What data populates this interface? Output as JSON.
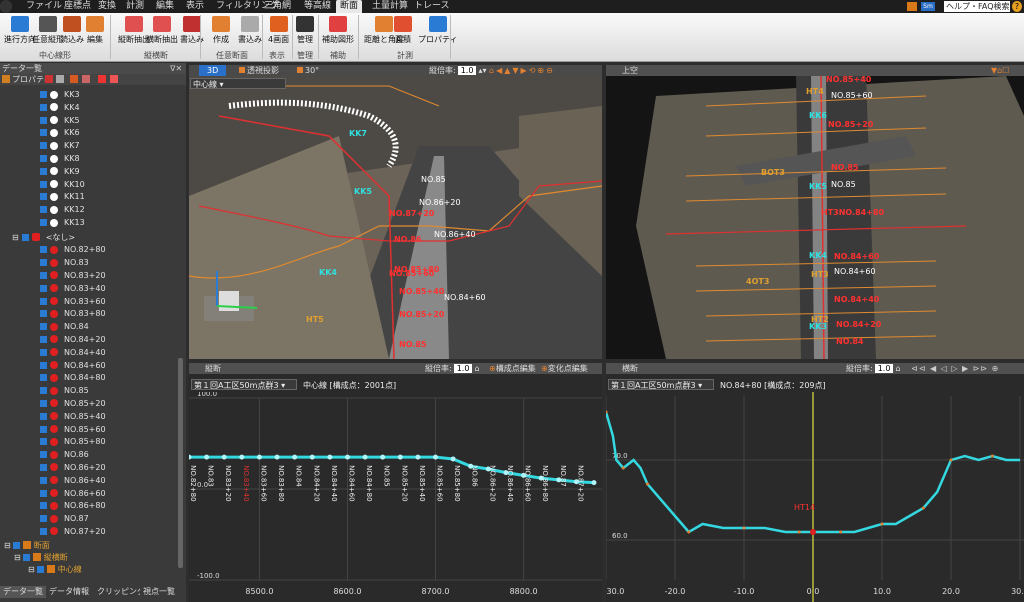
{
  "menu": {
    "tabs": [
      "ファイル",
      "座標点",
      "変換",
      "計測",
      "編集",
      "表示",
      "フィルタリング",
      "三角網",
      "等高線",
      "断面",
      "土量計算",
      "トレース"
    ],
    "active": "断面",
    "help_search": "ヘルプ・FAQ検索",
    "help_btn": "?"
  },
  "ribbon": {
    "buttons": [
      "進行方向",
      "任意縦形",
      "読込み",
      "編集",
      "縦断抽出",
      "横断抽出",
      "書込み",
      "作成",
      "書込み",
      "4画面",
      "管理",
      "補助図形",
      "距離と角度",
      "面積",
      "プロパティ"
    ],
    "groups": [
      "中心線形",
      "縦横断",
      "任意断面",
      "表示",
      "管理",
      "補助",
      "計測"
    ]
  },
  "left_panel": {
    "title": "データ一覧",
    "toolbar_label": "プロパティ",
    "kk_items": [
      "KK3",
      "KK4",
      "KK5",
      "KK6",
      "KK7",
      "KK8",
      "KK9",
      "KK10",
      "KK11",
      "KK12",
      "KK13"
    ],
    "group_label": "<なし>",
    "no_items": [
      "NO.82+80",
      "NO.83",
      "NO.83+20",
      "NO.83+40",
      "NO.83+60",
      "NO.83+80",
      "NO.84",
      "NO.84+20",
      "NO.84+40",
      "NO.84+60",
      "NO.84+80",
      "NO.85",
      "NO.85+20",
      "NO.85+40",
      "NO.85+60",
      "NO.85+80",
      "NO.86",
      "NO.86+20",
      "NO.86+40",
      "NO.86+60",
      "NO.86+80",
      "NO.87",
      "NO.87+20"
    ],
    "section_label": "断面",
    "longitudinal_label": "縦横断",
    "center_label": "中心線",
    "bottom_tabs": [
      "データ一覧",
      "データ情報",
      "クリッピング",
      "視点一覧"
    ]
  },
  "view3d": {
    "tab_3d": "3D",
    "tab_proj": "透視投影",
    "angle": "30°",
    "exag_label": "縦倍率:",
    "exag_value": "1.0",
    "combo": "中心線",
    "labels_red": [
      "NO.87+20",
      "NO.86",
      "NO.85+80",
      "NO.85+40",
      "NO.85+20",
      "NO.85",
      "NO.85+60"
    ],
    "labels_white": [
      "NO.86+40",
      "NO.86+20",
      "NO.85",
      "NO.84+60"
    ],
    "labels_cyan": [
      "KK5",
      "KK4",
      "HT5",
      "KK7"
    ]
  },
  "view_top": {
    "title": "上空",
    "labels_red": [
      "NO.85+40",
      "NO.85+20",
      "NO.85",
      "HT3NO.84+80",
      "NO.84+60",
      "NO.84+40",
      "NO.84+20",
      "NO.84"
    ],
    "labels_white": [
      "NO.85+60",
      "NO.85",
      "NO.84+60"
    ],
    "labels_cyan": [
      "KK6",
      "KK5",
      "KK4",
      "KK3"
    ],
    "labels_orange": [
      "HT4",
      "BOT3",
      "HT3",
      "4OT3",
      "HT2"
    ]
  },
  "view_long": {
    "title": "縦断",
    "exag_label": "縦倍率:",
    "exag_value": "1.0",
    "edit1": "構成点編集",
    "edit2": "変化点編集",
    "combo": "第１回A工区50m点群3",
    "info": "中心線 [構成点：2001点]",
    "station_labels": [
      "NO.82+80",
      "NO.83",
      "NO.83+20",
      "NO.83+40",
      "NO.83+60",
      "NO.83+80",
      "NO.84",
      "NO.84+20",
      "NO.84+40",
      "NO.84+60",
      "NO.84+80",
      "NO.85",
      "NO.85+20",
      "NO.85+40",
      "NO.85+60",
      "NO.85+80",
      "NO.86",
      "NO.86+20",
      "NO.86+40",
      "NO.86+60",
      "NO.86+80",
      "NO.87",
      "NO.87+20"
    ]
  },
  "view_cross": {
    "title": "横断",
    "exag_label": "縦倍率:",
    "exag_value": "1.0",
    "combo": "第１回A工区50m点群3",
    "info": "NO.84+80 [構成点：209点]",
    "marker": "HT14"
  },
  "chart_data": [
    {
      "type": "line",
      "title": "",
      "xlabel": "",
      "ylabel": "",
      "x_ticks": [
        "8500.0",
        "8600.0",
        "8700.0",
        "8800.0"
      ],
      "y_ticks": [
        "100.0",
        "0.0",
        "-100.0"
      ],
      "xlim": [
        8420,
        8880
      ],
      "ylim": [
        -100,
        100
      ],
      "series": [
        {
          "x": [
            8420,
            8440,
            8460,
            8480,
            8500,
            8520,
            8540,
            8560,
            8580,
            8600,
            8620,
            8640,
            8660,
            8680,
            8700,
            8720,
            8740,
            8760,
            8780,
            8800,
            8820,
            8840,
            8860,
            8880
          ],
          "y": [
            35,
            35,
            35,
            35,
            35,
            35,
            35,
            35,
            35,
            35,
            35,
            35,
            35,
            35,
            35,
            33,
            25,
            22,
            18,
            15,
            12,
            10,
            8,
            7
          ]
        }
      ]
    },
    {
      "type": "line",
      "title": "",
      "xlabel": "",
      "ylabel": "",
      "x_ticks": [
        "-30.0",
        "-20.0",
        "-10.0",
        "0.0",
        "10.0",
        "20.0",
        "30.0"
      ],
      "y_ticks": [
        "70.0",
        "60.0"
      ],
      "xlim": [
        -30,
        30
      ],
      "ylim": [
        55,
        78
      ],
      "series": [
        {
          "x": [
            -30,
            -29,
            -28.5,
            -27.5,
            -26,
            -25,
            -24,
            -22,
            -20,
            -18,
            -16,
            -13,
            -10,
            -7,
            -4,
            -2,
            0,
            2,
            4,
            6,
            8,
            10,
            12,
            14,
            16,
            18,
            19,
            20,
            22,
            24,
            26,
            28,
            30
          ],
          "y": [
            76,
            73,
            70,
            69,
            70,
            69,
            67,
            65,
            63,
            61,
            62,
            61.5,
            61.5,
            61.5,
            61,
            61,
            61,
            61,
            61,
            61,
            61.5,
            62,
            62,
            63,
            64,
            66,
            68,
            70,
            70.5,
            70,
            70.5,
            70,
            70
          ]
        }
      ]
    }
  ]
}
